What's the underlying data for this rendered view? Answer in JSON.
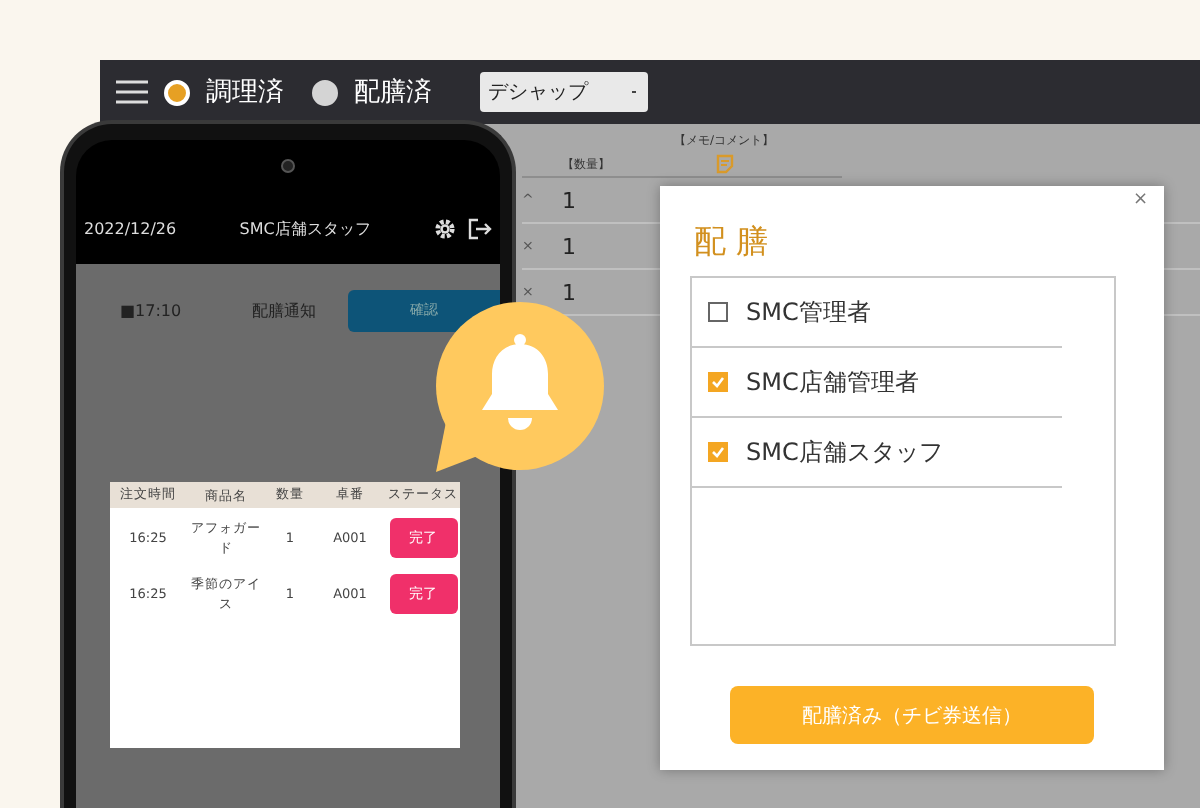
{
  "top_bar": {
    "radios": [
      {
        "label": "調理済",
        "selected": true
      },
      {
        "label": "配膳済",
        "selected": false
      }
    ],
    "dropdown": {
      "value": "デシャップ"
    }
  },
  "table": {
    "columns": [
      "【数量】",
      "【メモ/コメント】"
    ],
    "rows": [
      {
        "marker": "^",
        "quantity": "1"
      },
      {
        "marker": "×",
        "quantity": "1"
      },
      {
        "marker": "×",
        "quantity": "1"
      }
    ]
  },
  "phone": {
    "date": "2022/12/26",
    "user": "SMC店舗スタッフ",
    "time": "■17:10",
    "notice": "配膳通知",
    "confirm_button": "確認",
    "orders": {
      "columns": [
        "注文時間",
        "商品名",
        "数量",
        "卓番",
        "ステータス"
      ],
      "rows": [
        {
          "time": "16:25",
          "item": "アフォガード",
          "quantity": "1",
          "table": "A001",
          "status": "完了"
        },
        {
          "time": "16:25",
          "item": "季節のアイス",
          "quantity": "1",
          "table": "A001",
          "status": "完了"
        }
      ]
    }
  },
  "dialog": {
    "close": "×",
    "title": "配 膳",
    "options": [
      {
        "label": "SMC管理者",
        "checked": false
      },
      {
        "label": "SMC店舗管理者",
        "checked": true
      },
      {
        "label": "SMC店舗スタッフ",
        "checked": true
      }
    ],
    "button": "配膳済み（チビ券送信）"
  }
}
